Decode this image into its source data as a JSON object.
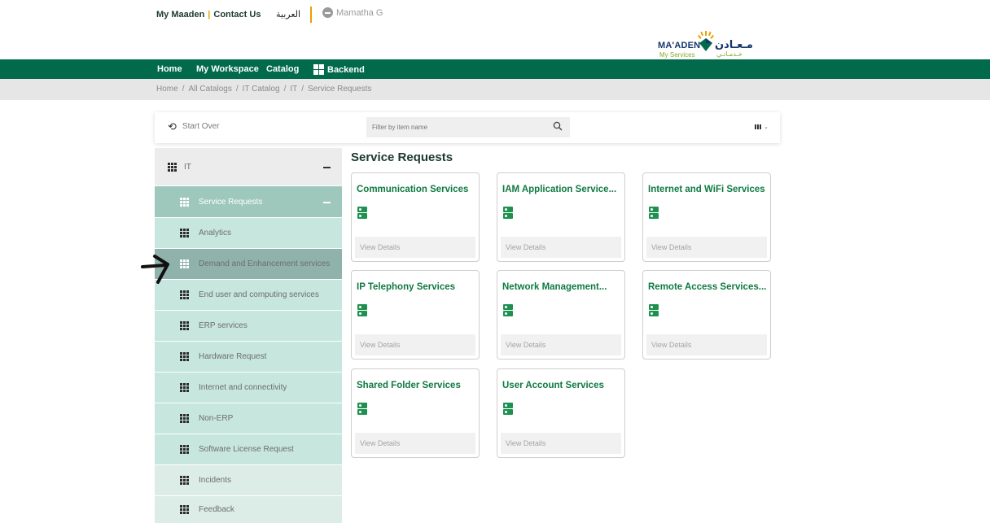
{
  "header": {
    "link_my_maaden": "My Maaden",
    "separator": "|",
    "link_contact": "Contact Us",
    "language": "العربية",
    "user_name": "Mamatha G",
    "logo": {
      "en": "MA'ADEN",
      "ar": "مـعـادن",
      "sub_en": "My Services",
      "sub_ar": "خـدمـاتـي"
    }
  },
  "nav": {
    "home": "Home",
    "workspace": "My Workspace",
    "catalog": "Catalog",
    "backend": "Backend"
  },
  "breadcrumb": [
    "Home",
    "All Catalogs",
    "IT Catalog",
    "IT",
    "Service Requests"
  ],
  "breadcrumb_sep": "/",
  "search": {
    "start_over": "Start Over",
    "placeholder": "Filter by item name"
  },
  "sidebar": {
    "root": "IT",
    "items": [
      "Service Requests",
      "Analytics",
      "Demand and Enhancement services",
      "End user and computing services",
      "ERP services",
      "Hardware Request",
      "Internet and connectivity",
      "Non-ERP",
      "Software License Request",
      "Incidents",
      "Feedback"
    ]
  },
  "main": {
    "title": "Service Requests",
    "view_details": "View Details",
    "cards": [
      "Communication Services",
      "IAM Application Service...",
      "Internet and WiFi Services",
      "IP Telephony Services",
      "Network Management...",
      "Remote Access Services...",
      "Shared Folder Services",
      "User Account Services"
    ]
  },
  "colors": {
    "brand_green": "#006a4a",
    "accent_orange": "#e8a000",
    "card_title_green": "#0f7a42",
    "sidebar_sub": "#c7e6de",
    "sidebar_active": "#9fc8bd",
    "sidebar_highlight": "#8fb3aa"
  },
  "icons": {
    "card_icon": "server-icon",
    "sidebar_icon": "grid-icon"
  }
}
